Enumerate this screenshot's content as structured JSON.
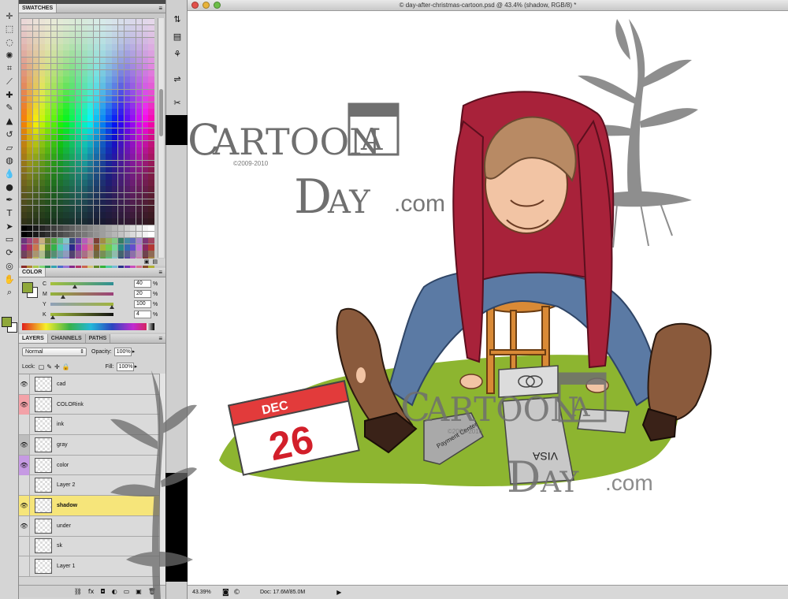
{
  "window": {
    "title": "© day-after-christmas-cartoon.psd @ 43.4% (shadow, RGB/8) *"
  },
  "tools": [
    {
      "name": "move",
      "glyph": "✛"
    },
    {
      "name": "marquee",
      "glyph": "⬚"
    },
    {
      "name": "lasso",
      "glyph": "◌"
    },
    {
      "name": "quick-select",
      "glyph": "✺"
    },
    {
      "name": "crop",
      "glyph": "⌗"
    },
    {
      "name": "eyedropper",
      "glyph": "⟋"
    },
    {
      "name": "healing",
      "glyph": "✚"
    },
    {
      "name": "brush",
      "glyph": "✎"
    },
    {
      "name": "stamp",
      "glyph": "▲"
    },
    {
      "name": "history-brush",
      "glyph": "↺"
    },
    {
      "name": "eraser",
      "glyph": "▱"
    },
    {
      "name": "paint-bucket",
      "glyph": "◍"
    },
    {
      "name": "blur",
      "glyph": "💧"
    },
    {
      "name": "dodge",
      "glyph": "●"
    },
    {
      "name": "pen",
      "glyph": "✒"
    },
    {
      "name": "type",
      "glyph": "T"
    },
    {
      "name": "path-select",
      "glyph": "➤"
    },
    {
      "name": "shape",
      "glyph": "▭"
    },
    {
      "name": "3d-rotate",
      "glyph": "⟳"
    },
    {
      "name": "3d-orbit",
      "glyph": "◎"
    },
    {
      "name": "hand",
      "glyph": "✋"
    },
    {
      "name": "zoom",
      "glyph": "⌕"
    }
  ],
  "swatches_panel": {
    "tab": "SWATCHES",
    "menu": "≡"
  },
  "color_panel": {
    "tab": "COLOR",
    "foreground": "#8fa83a",
    "sliders": [
      {
        "label": "C",
        "value": "40",
        "unit": "%",
        "level": 0.4,
        "gradient": "linear-gradient(90deg,#a6c13b,#2e8f95)"
      },
      {
        "label": "M",
        "value": "20",
        "unit": "%",
        "level": 0.2,
        "gradient": "linear-gradient(90deg,#93b43a,#9c3f7a)"
      },
      {
        "label": "Y",
        "value": "100",
        "unit": "%",
        "level": 1.0,
        "gradient": "linear-gradient(90deg,#8fa0b8,#9fb33a)"
      },
      {
        "label": "K",
        "value": "4",
        "unit": "%",
        "level": 0.04,
        "gradient": "linear-gradient(90deg,#a3bd3c,#101010)"
      }
    ]
  },
  "layers_panel": {
    "tabs": [
      "LAYERS",
      "CHANNELS",
      "PATHS"
    ],
    "blend_mode": "Normal",
    "opacity_label": "Opacity:",
    "opacity": "100%",
    "lock_label": "Lock:",
    "fill_label": "Fill:",
    "fill": "100%",
    "layers": [
      {
        "name": "cad",
        "visible": true,
        "vis_color": "none",
        "active": false
      },
      {
        "name": "COLORink",
        "visible": true,
        "vis_color": "pink",
        "active": false
      },
      {
        "name": "ink",
        "visible": false,
        "vis_color": "none",
        "active": false
      },
      {
        "name": "gray",
        "visible": true,
        "vis_color": "gray",
        "active": false
      },
      {
        "name": "color",
        "visible": true,
        "vis_color": "violet",
        "active": false
      },
      {
        "name": "Layer 2",
        "visible": false,
        "vis_color": "none",
        "active": false
      },
      {
        "name": "shadow",
        "visible": true,
        "vis_color": "none",
        "active": true
      },
      {
        "name": "under",
        "visible": true,
        "vis_color": "none",
        "active": false
      },
      {
        "name": "sk",
        "visible": false,
        "vis_color": "none",
        "active": false
      },
      {
        "name": "Layer 1",
        "visible": false,
        "vis_color": "none",
        "active": false
      }
    ],
    "footer_icons": [
      "link-icon",
      "fx-icon",
      "mask-icon",
      "adjustment-icon",
      "group-icon",
      "new-layer-icon",
      "trash-icon"
    ]
  },
  "status": {
    "zoom": "43.39%",
    "doc": "Doc: 17.6M/85.0M"
  },
  "artwork": {
    "calendar_month": "DEC",
    "calendar_day": "26",
    "watermark_logo_top": "ARTOON",
    "watermark_logo_a": "A",
    "watermark_day": "AY",
    "watermark_com": ".com",
    "watermark_copy": "©2009-2010",
    "visa_text": "VISA",
    "receipt_text": "Payment Center",
    "grass_color": "#8db530",
    "sweater_color": "#a8223a",
    "jeans_color": "#5b7aa4"
  }
}
